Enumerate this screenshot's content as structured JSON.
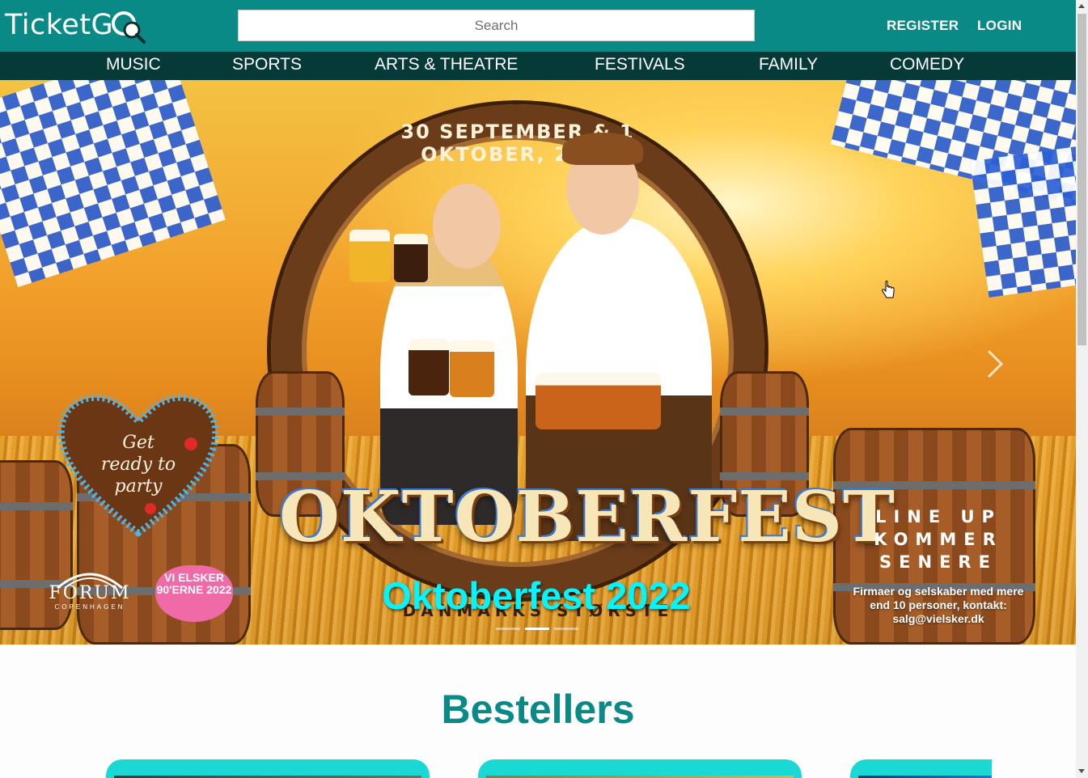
{
  "header": {
    "logo_text": "TicketG",
    "logo_icon": "magnifier-ticket-icon",
    "search_placeholder": "Search",
    "register_label": "REGISTER",
    "login_label": "LOGIN",
    "brand_color": "#0a8a87"
  },
  "nav": {
    "items": [
      {
        "label": "MUSIC"
      },
      {
        "label": "SPORTS"
      },
      {
        "label": "ARTS & THEATRE"
      },
      {
        "label": "FESTIVALS"
      },
      {
        "label": "FAMILY"
      },
      {
        "label": "COMEDY"
      }
    ],
    "background": "#053a38"
  },
  "hero": {
    "date_text": "30 SEPTEMBER & 1 OKTOBER, 2022",
    "poster_title": "OKTOBERFEST",
    "poster_subtitle": "DANMARKS STØRSTE",
    "heart_text": "Get ready to party",
    "lineup_lines": [
      "LINE UP",
      "KOMMER",
      "SENERE"
    ],
    "lineup_note": "Firmaer og selskaber med mere end 10 personer, kontakt: salg@vielsker.dk",
    "venue_name": "FORUM",
    "venue_city": "COPENHAGEN",
    "badge_text": "VI ELSKER 90'ERNE 2022",
    "caption": "Oktoberfest 2022",
    "caption_color": "#00f6ff",
    "slides": 3,
    "active_slide": 2,
    "next_icon": "chevron-right-icon"
  },
  "bestsellers": {
    "title": "Bestellers",
    "cards": 3
  }
}
